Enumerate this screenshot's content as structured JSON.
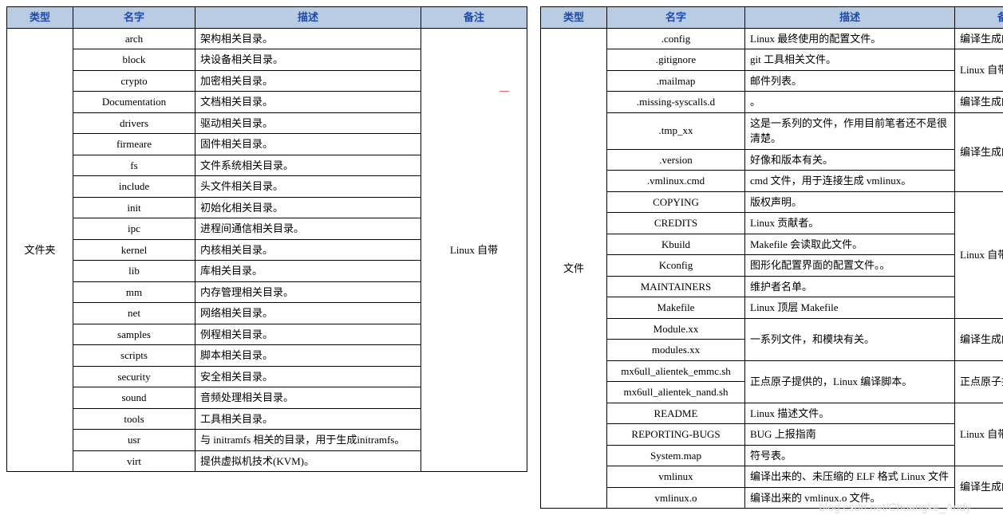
{
  "headers": {
    "type": "类型",
    "name": "名字",
    "desc": "描述",
    "remark": "备注"
  },
  "left": {
    "typeLabel": "文件夹",
    "remarkLabel": "Linux 自带",
    "rows": [
      {
        "name": "arch",
        "desc": "架构相关目录。"
      },
      {
        "name": "block",
        "desc": "块设备相关目录。"
      },
      {
        "name": "crypto",
        "desc": "加密相关目录。"
      },
      {
        "name": "Documentation",
        "desc": "文档相关目录。"
      },
      {
        "name": "drivers",
        "desc": "驱动相关目录。"
      },
      {
        "name": "firmeare",
        "desc": "固件相关目录。"
      },
      {
        "name": "fs",
        "desc": "文件系统相关目录。"
      },
      {
        "name": "include",
        "desc": "头文件相关目录。"
      },
      {
        "name": "init",
        "desc": "初始化相关目录。"
      },
      {
        "name": "ipc",
        "desc": "进程间通信相关目录。"
      },
      {
        "name": "kernel",
        "desc": "内核相关目录。"
      },
      {
        "name": "lib",
        "desc": "库相关目录。"
      },
      {
        "name": "mm",
        "desc": "内存管理相关目录。"
      },
      {
        "name": "net",
        "desc": "网络相关目录。"
      },
      {
        "name": "samples",
        "desc": "例程相关目录。"
      },
      {
        "name": "scripts",
        "desc": "脚本相关目录。"
      },
      {
        "name": "security",
        "desc": "安全相关目录。"
      },
      {
        "name": "sound",
        "desc": "音频处理相关目录。"
      },
      {
        "name": "tools",
        "desc": "工具相关目录。"
      },
      {
        "name": "usr",
        "desc": "与 initramfs 相关的目录，用于生成initramfs。"
      },
      {
        "name": "virt",
        "desc": "提供虚拟机技术(KVM)。"
      }
    ]
  },
  "right": {
    "typeLabel": "文件",
    "groups": [
      {
        "remark": "编译生成的文件。",
        "rows": [
          {
            "name": ".config",
            "desc": "Linux 最终使用的配置文件。"
          }
        ]
      },
      {
        "remark": "Linux 自带",
        "rows": [
          {
            "name": ".gitignore",
            "desc": "git 工具相关文件。"
          },
          {
            "name": ".mailmap",
            "desc": "邮件列表。"
          }
        ]
      },
      {
        "remark": "编译生成的文件",
        "rows": [
          {
            "name": ".missing-syscalls.d",
            "desc": "。"
          }
        ]
      },
      {
        "remark": "编译生成的文件",
        "rows": [
          {
            "name": ".tmp_xx",
            "desc": "这是一系列的文件，作用目前笔者还不是很清楚。"
          },
          {
            "name": ".version",
            "desc": "好像和版本有关。"
          },
          {
            "name": ".vmlinux.cmd",
            "desc": "cmd 文件，用于连接生成 vmlinux。"
          }
        ]
      },
      {
        "remark": "Linux 自带",
        "rows": [
          {
            "name": "COPYING",
            "desc": "版权声明。"
          },
          {
            "name": "CREDITS",
            "desc": "Linux 贡献者。"
          },
          {
            "name": "Kbuild",
            "desc": "Makefile 会读取此文件。"
          },
          {
            "name": "Kconfig",
            "desc": "图形化配置界面的配置文件。。"
          },
          {
            "name": "MAINTAINERS",
            "desc": "维护者名单。"
          },
          {
            "name": "Makefile",
            "desc": "Linux 顶层 Makefile"
          }
        ]
      },
      {
        "remark": "编译生成的文件",
        "rows": [
          {
            "names": [
              "Module.xx",
              "modules.xx"
            ],
            "desc": "一系列文件，和模块有关。"
          }
        ]
      },
      {
        "remark": "正点原子提供",
        "rows": [
          {
            "names": [
              "mx6ull_alientek_emmc.sh",
              "mx6ull_alientek_nand.sh"
            ],
            "desc": "正点原子提供的，Linux 编译脚本。"
          }
        ]
      },
      {
        "remark": "Linux 自带",
        "rows": [
          {
            "name": "README",
            "desc": "Linux 描述文件。"
          },
          {
            "name": "REPORTING-BUGS",
            "desc": "BUG 上报指南"
          },
          {
            "name": "System.map",
            "desc": "符号表。"
          }
        ]
      },
      {
        "remark": "编译生成的文件",
        "rows": [
          {
            "name": "vmlinux",
            "desc": "编译出来的、未压缩的 ELF 格式 Linux 文件"
          },
          {
            "name": "vmlinux.o",
            "desc": "编译出来的 vmlinux.o 文件。"
          }
        ]
      }
    ]
  },
  "watermark": "blog.csdn.net/Chuangke_Andy"
}
